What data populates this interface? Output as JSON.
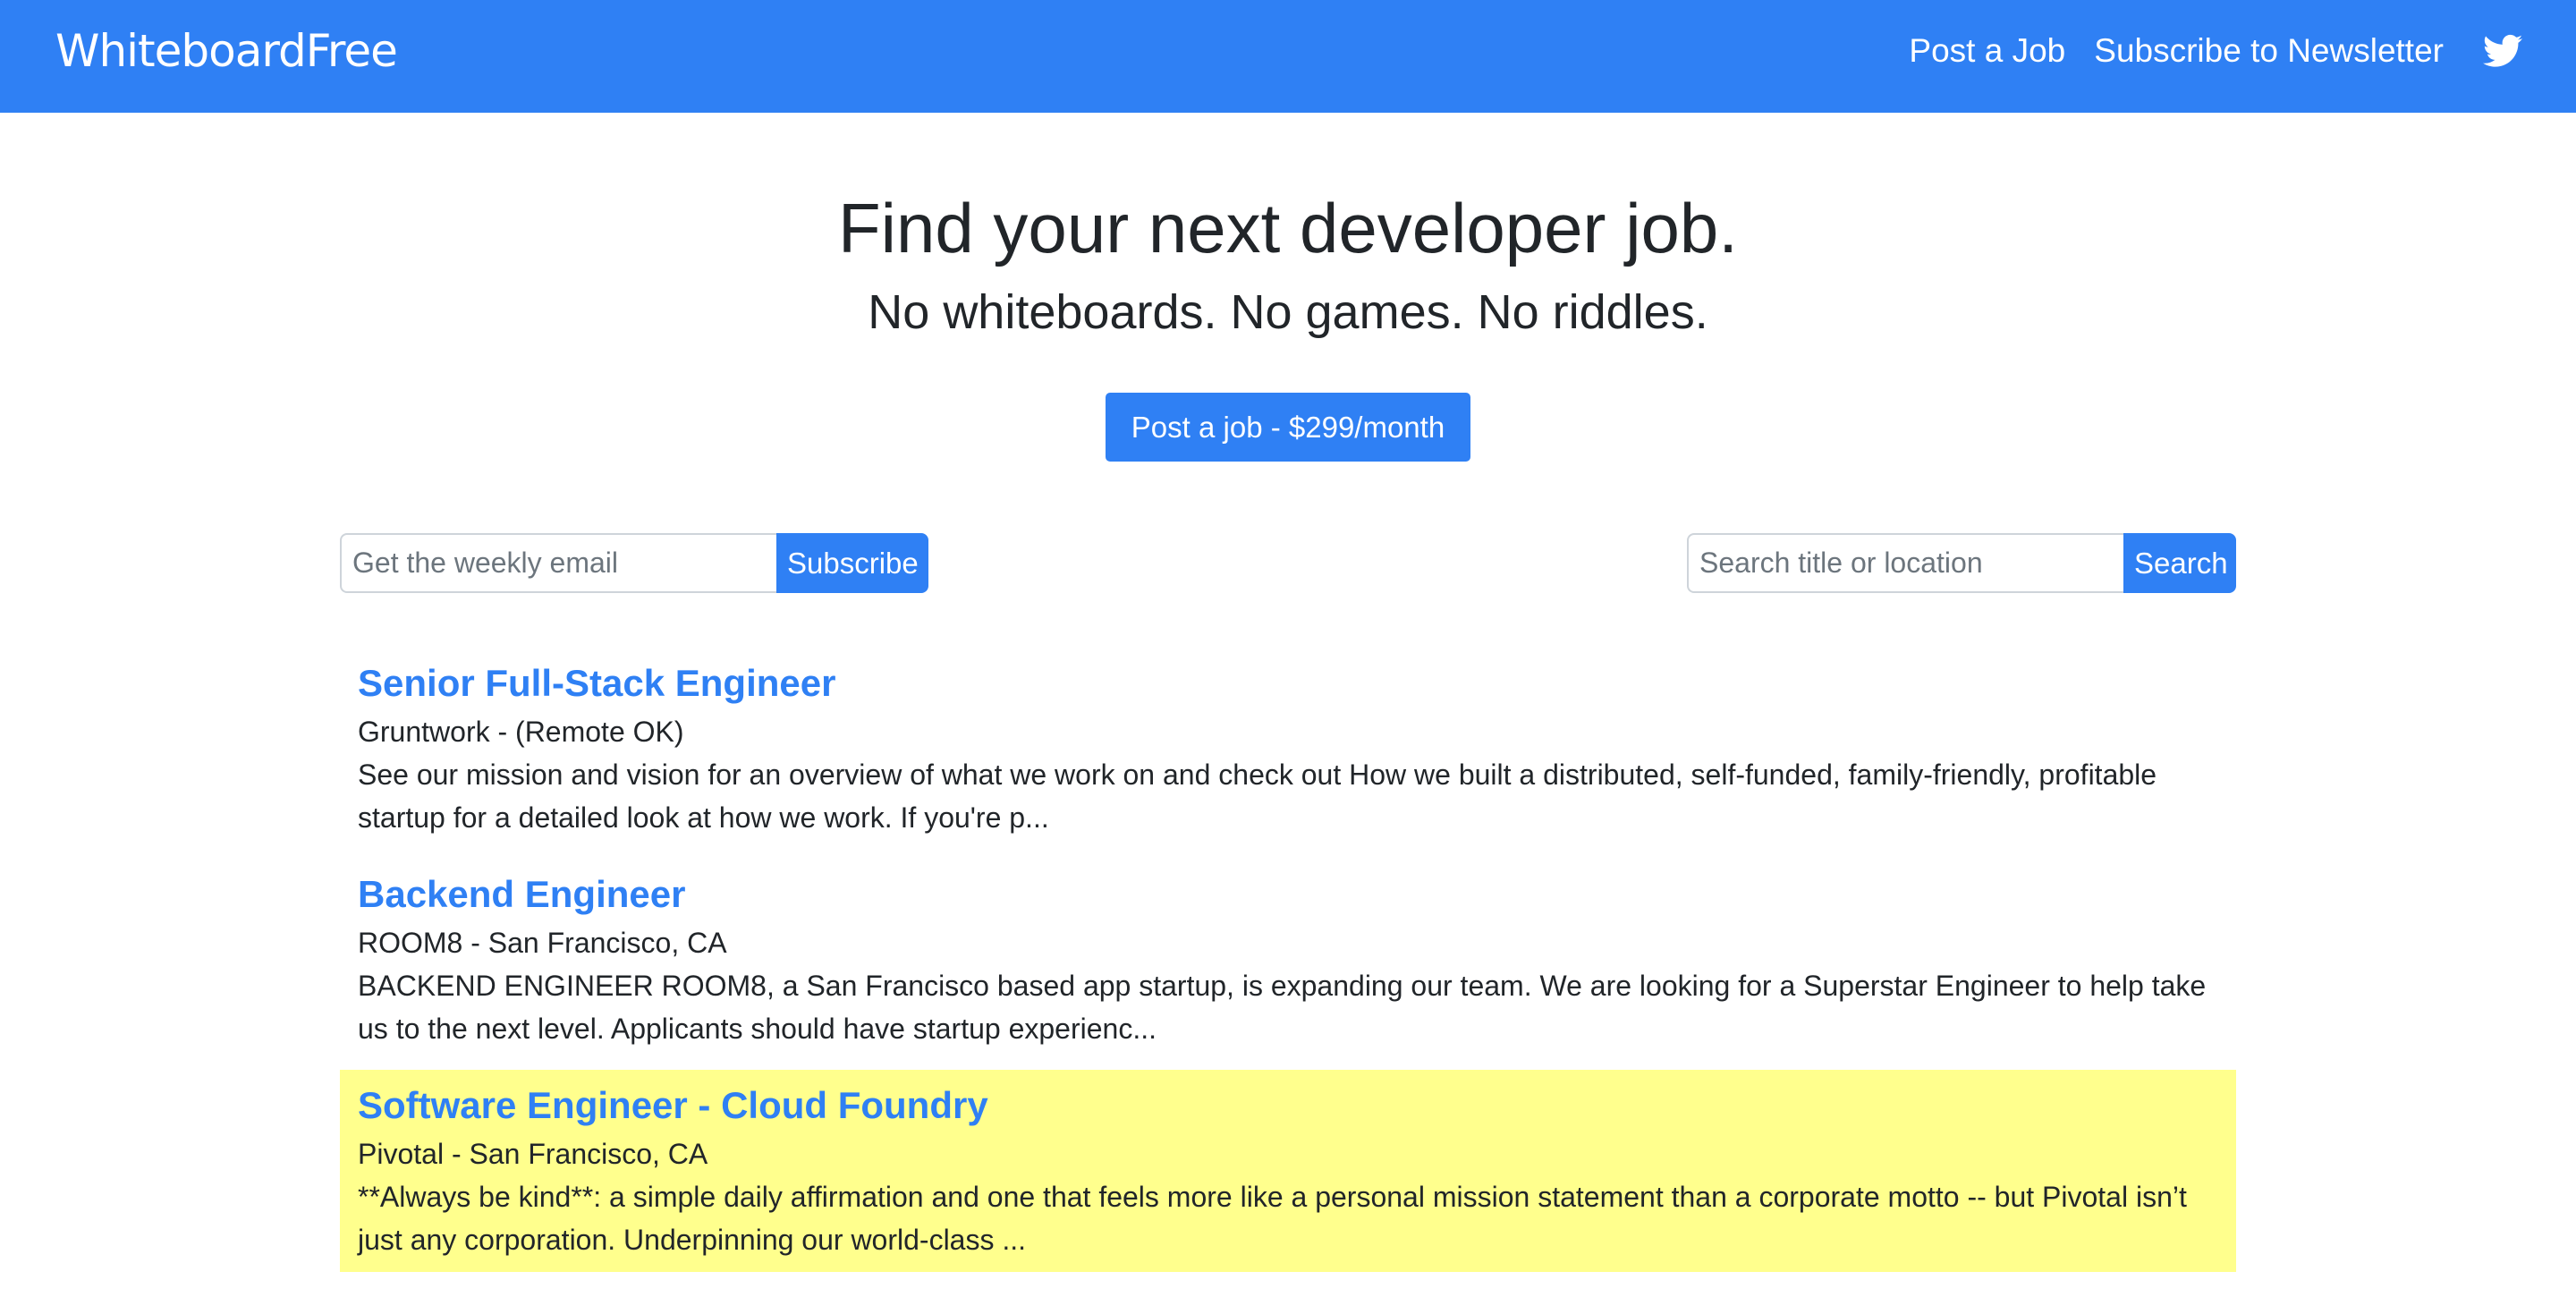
{
  "brand": "WhiteboardFree",
  "nav": {
    "post_job": "Post a Job",
    "subscribe": "Subscribe to Newsletter",
    "twitter_icon": "twitter-bird-icon"
  },
  "hero": {
    "title": "Find your next developer job.",
    "subtitle": "No whiteboards. No games. No riddles.",
    "cta": "Post a job - $299/month"
  },
  "subscribe_form": {
    "placeholder": "Get the weekly email",
    "button": "Subscribe"
  },
  "search_form": {
    "placeholder": "Search title or location",
    "button": "Search"
  },
  "jobs": [
    {
      "title": "Senior Full-Stack Engineer",
      "company": "Gruntwork - (Remote OK)",
      "description": "See our mission and vision for an overview of what we work on and check out How we built a distributed, self-funded, family-friendly, profitable startup for a detailed look at how we work. If you're p..."
    },
    {
      "title": "Backend Engineer",
      "company": "ROOM8 - San Francisco, CA",
      "description": "BACKEND ENGINEER ROOM8, a San Francisco based app startup, is expanding our team. We are looking for a Superstar Engineer to help take us to the next level. Applicants should have startup experienc..."
    },
    {
      "title": "Software Engineer - Cloud Foundry",
      "company": "Pivotal - San Francisco, CA",
      "description": "**Always be kind**: a simple daily affirmation and one that feels more like a personal mission statement than a corporate motto -- but Pivotal isn’t just any corporation. Underpinning our world-class ...",
      "highlighted": true
    }
  ],
  "colors": {
    "primary": "#2f80f4",
    "highlight": "#ffff8d",
    "text": "#212529"
  }
}
